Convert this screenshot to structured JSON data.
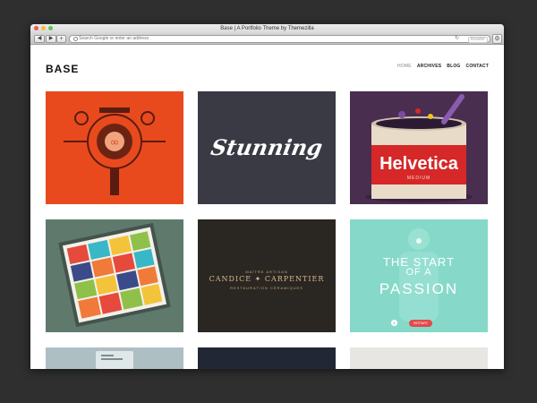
{
  "browser": {
    "window_title": "Base | A Portfolio Theme by Themezilla",
    "back_glyph": "◀",
    "forward_glyph": "▶",
    "new_tab_glyph": "+",
    "address_placeholder": "Search Google or enter an address",
    "reload_glyph": "↻",
    "reader_label": "Reader",
    "gear_glyph": "⚙",
    "icons": [
      "back-arrow-icon",
      "forward-arrow-icon",
      "plus-icon",
      "search-icon",
      "reload-icon",
      "gear-icon"
    ]
  },
  "site": {
    "title": "BASE",
    "nav": {
      "home": "HOME",
      "archives": "ARCHIVES",
      "blog": "BLOG",
      "contact": "CONTACT"
    }
  },
  "tiles": {
    "t2_text": "Stunning",
    "t3_label": "Helvetica",
    "t3_sub": "MEDIUM",
    "t5_top": "MAÎTRE ARTISAN",
    "t5_name": "CANDICE ✦ CARPENTIER",
    "t5_bottom": "RESTAURATION CÉRAMIQUES",
    "t6_line1": "THE START",
    "t6_line2": "OF A",
    "t6_line3": "PASSION",
    "t6_badge": "RESTART",
    "t6_num": "1"
  },
  "colors": {
    "t1": "#e84a1d",
    "t2": "#3a3a45",
    "t3": "#4a2e4f",
    "t4": "#5f7a6c",
    "t5": "#2a2622",
    "t6": "#86d9c9"
  }
}
